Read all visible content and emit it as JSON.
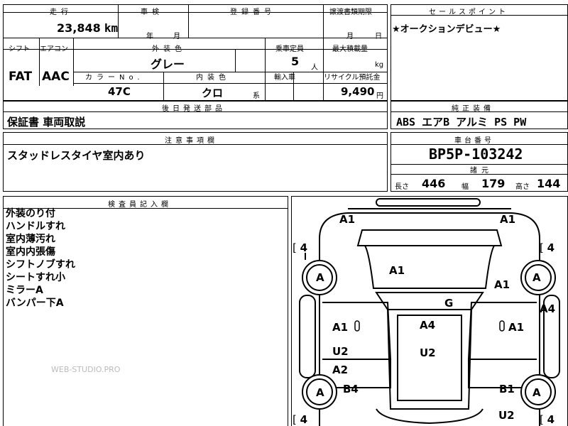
{
  "header": {
    "mileage_label": "走行",
    "inspection_label": "車検",
    "registration_label": "登録番号",
    "transfer_label": "譲渡書類期限",
    "sales_label": "セールスポイント"
  },
  "mileage": {
    "value": "23,848",
    "unit": "km"
  },
  "inspection": {
    "year_unit": "年",
    "month_unit": "月"
  },
  "transfer": {
    "month_unit": "月",
    "day_unit": "日"
  },
  "sales_point": "★オークションデビュー★",
  "row2": {
    "shift_label": "シフト",
    "aircon_label": "エアコン",
    "exterior_label": "外装色",
    "capacity_label": "乗車定員",
    "max_load_label": "最大積載量",
    "shift": "FAT",
    "aircon": "AAC",
    "exterior_color": "グレー",
    "capacity": "5",
    "capacity_unit": "人",
    "max_load_unit": "kg",
    "color_no_label": "カラーNo.",
    "interior_label": "内装色",
    "import_label": "輸入車",
    "recycle_label": "リサイクル預託金",
    "color_no": "47C",
    "interior_color": "クロ",
    "interior_unit": "系",
    "recycle_fee": "9,490",
    "recycle_unit": "円"
  },
  "later_parts": {
    "label": "後日発送部品",
    "value": "保証書 車両取説"
  },
  "equipment": {
    "label": "純正装備",
    "value": "ABS エアB アルミ PS PW"
  },
  "notes": {
    "label": "注意事項欄",
    "value": "スタッドレスタイヤ室内あり"
  },
  "chassis": {
    "label": "車台番号",
    "value": "BP5P-103242"
  },
  "specs": {
    "label": "諸元",
    "length_label": "長さ",
    "length": "446",
    "width_label": "幅",
    "width": "179",
    "height_label": "高さ",
    "height": "144"
  },
  "inspector": {
    "label": "検査員記入欄",
    "remarks": [
      "外装のり付",
      "ハンドルすれ",
      "室内薄汚れ",
      "室内内張傷",
      "シフトノブすれ",
      "シートすれ小",
      "ミラーA",
      "バンパー下A"
    ]
  },
  "watermark": "WEB-STUDIO.PRO",
  "diagram": {
    "labels": {
      "front_left": "A1",
      "front_right": "A1",
      "tire_fl": "4",
      "tire_fr": "4",
      "tire_rl": "4",
      "tire_rr": "4",
      "wheel_fl": "A",
      "wheel_fr": "A",
      "wheel_rl": "A",
      "wheel_rr": "A",
      "hood": "A1",
      "fender_r": "A1",
      "windshield": "G",
      "fender_r2": "A4",
      "door_fl": "A1",
      "roof": "A4",
      "door_fr": "A1",
      "door_rl": "U2",
      "roof_rear": "U2",
      "sill_l": "A2",
      "quarter_l": "B4",
      "quarter_r": "B1",
      "rear": "U2"
    }
  }
}
